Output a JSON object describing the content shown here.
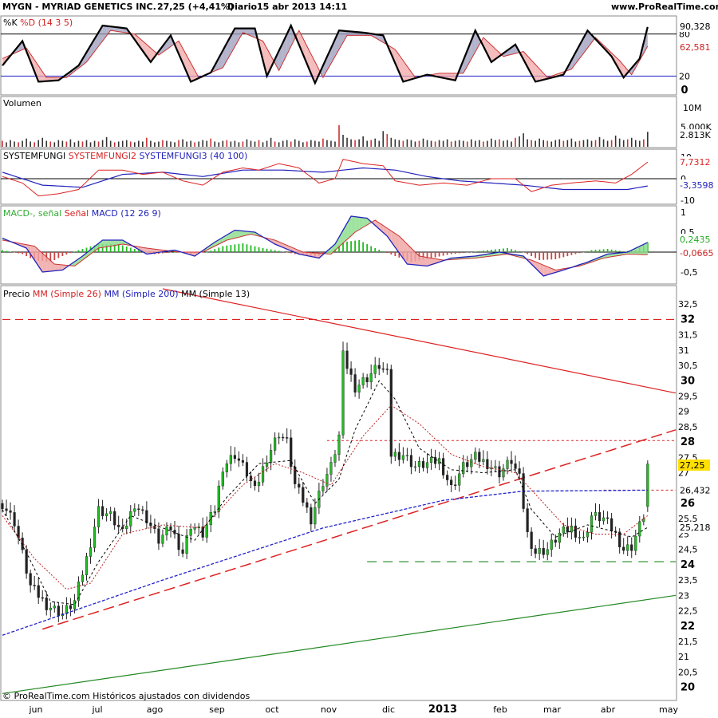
{
  "header": {
    "ticker": "MYGN - MYRIAD GENETICS INC.",
    "quote": "27,25 (+4,41%)",
    "period": "Diario",
    "datetime": "15 abr 2013 14:11",
    "site": "www.ProRealTime.com"
  },
  "footer": "© ProRealTime.com  Históricos ajustados con dividendos",
  "colors": {
    "price_up": "#22bb22",
    "ma26": "#bb2222",
    "ma200": "#2222cc",
    "ma13": "#000000",
    "resistance": "#dd2222",
    "support": "#228822",
    "macd_pos": "#22bb22",
    "macd_neg": "#cc4444"
  },
  "panels": {
    "stoch": {
      "label_a": "%K",
      "label_b": "%D (14 3 5)",
      "axis_top": "100",
      "ticks": [
        "80",
        "20",
        "0"
      ],
      "tag_k": "90,328",
      "tag_d": "62,581"
    },
    "volume": {
      "label": "Volumen",
      "ticks": [
        "10M",
        "5.000K"
      ],
      "tag": "2.813K"
    },
    "sysf": {
      "label_a": "SYSTEMFUNGI",
      "label_b": "SYSTEMFUNGI2",
      "label_c": "SYSTEMFUNGI3 (40 100)",
      "ticks": [
        "10",
        "0",
        "-10"
      ],
      "tag_a": "7,7312",
      "tag_b": "-3,3598"
    },
    "macd": {
      "label_a": "MACD-, señal",
      "label_b": "Señal",
      "label_c": "MACD (12 26 9)",
      "ticks": [
        "1",
        "0,5",
        "-0,5"
      ],
      "tag_a": "0,2435",
      "tag_b": "-0,0665"
    },
    "price": {
      "label_a": "Precio",
      "label_b": "MM (Simple 26)",
      "label_c": "MM (Simple 200)",
      "label_d": "MM (Simple 13)",
      "tag_last": "27,25",
      "tag_ma200": "26,432",
      "tag_ma13": "25,218"
    }
  },
  "chart_data": {
    "type": "candlestick",
    "x_labels": [
      "jun",
      "jul",
      "ago",
      "sep",
      "oct",
      "nov",
      "dic",
      "2013",
      "feb",
      "mar",
      "abr",
      "may"
    ],
    "y_ticks": [
      "32,5",
      "32",
      "31,5",
      "31",
      "30,5",
      "30",
      "29,5",
      "29",
      "28,5",
      "28",
      "27,5",
      "27",
      "26,5",
      "26",
      "25,5",
      "25",
      "24,5",
      "24",
      "23,5",
      "23",
      "22,5",
      "22",
      "21,5",
      "21",
      "20,5",
      "20"
    ],
    "y_ticks_bold": [
      "32",
      "30",
      "28",
      "26",
      "24",
      "22",
      "20"
    ],
    "ylim": [
      19.6,
      33.0
    ],
    "last_price": 27.25,
    "ma200_last": 26.432,
    "ma13_last": 25.218,
    "price_path": [
      [
        0,
        26.0
      ],
      [
        3,
        25.4
      ],
      [
        7,
        23.3
      ],
      [
        11,
        22.7
      ],
      [
        15,
        22.4
      ],
      [
        18,
        22.8
      ],
      [
        21,
        24.2
      ],
      [
        24,
        25.8
      ],
      [
        27,
        25.6
      ],
      [
        30,
        25.0
      ],
      [
        33,
        26.0
      ],
      [
        36,
        25.5
      ],
      [
        39,
        24.8
      ],
      [
        42,
        25.2
      ],
      [
        45,
        24.4
      ],
      [
        47,
        25.3
      ],
      [
        50,
        25.0
      ],
      [
        53,
        25.8
      ],
      [
        55,
        27.2
      ],
      [
        58,
        27.6
      ],
      [
        61,
        27.0
      ],
      [
        63,
        26.4
      ],
      [
        66,
        27.5
      ],
      [
        69,
        28.3
      ],
      [
        71,
        28.0
      ],
      [
        73,
        26.6
      ],
      [
        75,
        26.1
      ],
      [
        77,
        25.5
      ],
      [
        80,
        26.7
      ],
      [
        82,
        27.2
      ],
      [
        84,
        28.2
      ],
      [
        85,
        30.8
      ],
      [
        88,
        29.8
      ],
      [
        91,
        30.1
      ],
      [
        94,
        30.5
      ],
      [
        96,
        30.2
      ],
      [
        97,
        27.6
      ],
      [
        100,
        27.6
      ],
      [
        103,
        27.2
      ],
      [
        106,
        27.3
      ],
      [
        109,
        27.4
      ],
      [
        112,
        26.5
      ],
      [
        115,
        27.2
      ],
      [
        118,
        27.5
      ],
      [
        121,
        27.3
      ],
      [
        124,
        27.0
      ],
      [
        127,
        27.4
      ],
      [
        129,
        26.8
      ],
      [
        131,
        25.0
      ],
      [
        133,
        24.4
      ],
      [
        136,
        24.5
      ],
      [
        139,
        25.0
      ],
      [
        142,
        25.2
      ],
      [
        145,
        24.8
      ],
      [
        147,
        25.6
      ],
      [
        150,
        25.5
      ],
      [
        153,
        25.0
      ],
      [
        155,
        24.5
      ],
      [
        157,
        24.6
      ],
      [
        160,
        25.6
      ],
      [
        161,
        27.25
      ]
    ],
    "ma26_path": [
      [
        0,
        25.6
      ],
      [
        8,
        24.2
      ],
      [
        16,
        23.2
      ],
      [
        22,
        23.4
      ],
      [
        30,
        25.0
      ],
      [
        40,
        25.3
      ],
      [
        50,
        25.2
      ],
      [
        60,
        26.6
      ],
      [
        68,
        27.3
      ],
      [
        75,
        27.0
      ],
      [
        82,
        26.6
      ],
      [
        90,
        28.2
      ],
      [
        97,
        29.2
      ],
      [
        104,
        28.6
      ],
      [
        112,
        27.6
      ],
      [
        120,
        27.2
      ],
      [
        128,
        27.0
      ],
      [
        133,
        26.3
      ],
      [
        140,
        25.3
      ],
      [
        148,
        25.0
      ],
      [
        155,
        25.0
      ],
      [
        161,
        25.6
      ]
    ],
    "ma13_path": [
      [
        0,
        25.8
      ],
      [
        6,
        24.4
      ],
      [
        12,
        22.8
      ],
      [
        18,
        22.7
      ],
      [
        24,
        24.1
      ],
      [
        32,
        25.6
      ],
      [
        40,
        25.2
      ],
      [
        48,
        24.8
      ],
      [
        56,
        26.2
      ],
      [
        64,
        27.3
      ],
      [
        72,
        27.4
      ],
      [
        78,
        26.0
      ],
      [
        84,
        26.8
      ],
      [
        88,
        28.4
      ],
      [
        94,
        30.0
      ],
      [
        98,
        29.4
      ],
      [
        104,
        27.8
      ],
      [
        112,
        27.1
      ],
      [
        120,
        27.0
      ],
      [
        128,
        27.1
      ],
      [
        132,
        25.8
      ],
      [
        138,
        24.9
      ],
      [
        146,
        25.3
      ],
      [
        152,
        25.1
      ],
      [
        157,
        24.9
      ],
      [
        161,
        25.218
      ]
    ],
    "ma200_path": [
      [
        0,
        21.7
      ],
      [
        40,
        23.5
      ],
      [
        80,
        25.2
      ],
      [
        110,
        26.1
      ],
      [
        130,
        26.4
      ],
      [
        161,
        26.432
      ]
    ],
    "levels": [
      {
        "name": "resistance-32",
        "value": 32.0,
        "x0": 0,
        "x1": 168,
        "style": "red-dashed"
      },
      {
        "name": "resistance-28",
        "value": 28.05,
        "x0": 81,
        "x1": 168,
        "style": "red-dotted"
      },
      {
        "name": "support-26-4",
        "value": 26.432,
        "x0": 150,
        "x1": 168,
        "style": "red-dotted"
      },
      {
        "name": "support-24-1",
        "value": 24.1,
        "x0": 91,
        "x1": 168,
        "style": "green-dashed"
      }
    ],
    "trendlines": [
      {
        "name": "downtrend-line",
        "from": [
          40,
          33.0
        ],
        "to": [
          168,
          29.6
        ],
        "style": "red-solid"
      },
      {
        "name": "uptrend-line",
        "from": [
          10,
          21.9
        ],
        "to": [
          168,
          28.4
        ],
        "style": "red-dashed"
      },
      {
        "name": "long-support-line",
        "from": [
          0,
          19.8
        ],
        "to": [
          168,
          23.0
        ],
        "style": "green-solid"
      }
    ],
    "stoch_k": [
      [
        0,
        35
      ],
      [
        5,
        70
      ],
      [
        9,
        12
      ],
      [
        14,
        14
      ],
      [
        19,
        35
      ],
      [
        25,
        92
      ],
      [
        31,
        88
      ],
      [
        37,
        40
      ],
      [
        42,
        78
      ],
      [
        47,
        12
      ],
      [
        52,
        25
      ],
      [
        58,
        88
      ],
      [
        63,
        88
      ],
      [
        66,
        20
      ],
      [
        72,
        92
      ],
      [
        78,
        10
      ],
      [
        84,
        85
      ],
      [
        90,
        82
      ],
      [
        95,
        78
      ],
      [
        100,
        12
      ],
      [
        106,
        22
      ],
      [
        113,
        14
      ],
      [
        118,
        85
      ],
      [
        122,
        40
      ],
      [
        128,
        65
      ],
      [
        133,
        12
      ],
      [
        140,
        22
      ],
      [
        146,
        85
      ],
      [
        152,
        48
      ],
      [
        155,
        18
      ],
      [
        159,
        45
      ],
      [
        161,
        90
      ]
    ],
    "stoch_d": [
      [
        0,
        45
      ],
      [
        6,
        60
      ],
      [
        11,
        18
      ],
      [
        16,
        18
      ],
      [
        21,
        40
      ],
      [
        27,
        85
      ],
      [
        33,
        80
      ],
      [
        39,
        50
      ],
      [
        44,
        70
      ],
      [
        49,
        18
      ],
      [
        55,
        32
      ],
      [
        60,
        82
      ],
      [
        65,
        70
      ],
      [
        69,
        28
      ],
      [
        74,
        85
      ],
      [
        80,
        18
      ],
      [
        86,
        78
      ],
      [
        92,
        78
      ],
      [
        98,
        58
      ],
      [
        103,
        18
      ],
      [
        109,
        24
      ],
      [
        115,
        24
      ],
      [
        120,
        75
      ],
      [
        125,
        48
      ],
      [
        130,
        55
      ],
      [
        136,
        18
      ],
      [
        142,
        30
      ],
      [
        148,
        75
      ],
      [
        154,
        42
      ],
      [
        157,
        22
      ],
      [
        161,
        62.581
      ]
    ],
    "volume": [
      0.8,
      0.6,
      0.9,
      0.7,
      0.6,
      0.8,
      1.1,
      0.7,
      0.6,
      0.9,
      1.2,
      0.8,
      0.7,
      0.6,
      0.9,
      0.8,
      0.7,
      1.0,
      0.6,
      0.8,
      0.7,
      0.9,
      0.6,
      0.8,
      0.7,
      0.9,
      1.3,
      0.8,
      0.6,
      0.7,
      0.8,
      0.9,
      0.7,
      0.6,
      0.8,
      0.7,
      1.2,
      0.8,
      0.6,
      0.7,
      0.9,
      0.8,
      0.7,
      0.6,
      0.9,
      1.0,
      0.7,
      0.8,
      0.6,
      0.7,
      0.9,
      0.8,
      1.1,
      0.7,
      0.6,
      0.8,
      0.9,
      0.7,
      0.8,
      0.6,
      0.7,
      1.0,
      0.8,
      0.7,
      0.9,
      0.6,
      0.8,
      1.2,
      0.7,
      0.6,
      0.8,
      0.9,
      0.7,
      1.0,
      0.8,
      0.6,
      0.7,
      0.9,
      0.8,
      0.7,
      1.1,
      0.9,
      0.8,
      0.7,
      2.9,
      1.6,
      1.2,
      1.0,
      0.9,
      1.0,
      1.4,
      0.8,
      0.9,
      1.1,
      0.8,
      2.1,
      1.7,
      1.2,
      1.0,
      0.9,
      0.8,
      1.0,
      0.9,
      0.7,
      0.8,
      1.1,
      0.9,
      0.8,
      0.7,
      0.9,
      0.8,
      1.0,
      0.7,
      0.8,
      0.9,
      0.8,
      0.7,
      1.0,
      0.8,
      0.9,
      0.7,
      0.8,
      1.1,
      0.9,
      1.0,
      0.8,
      0.9,
      0.7,
      1.2,
      1.4,
      1.8,
      1.0,
      0.9,
      0.8,
      1.1,
      0.9,
      0.8,
      0.7,
      0.9,
      1.0,
      0.8,
      0.9,
      1.1,
      0.7,
      0.8,
      0.9,
      1.0,
      0.8,
      0.9,
      1.3,
      1.0,
      0.8,
      0.9,
      1.5,
      1.1,
      0.9,
      1.0,
      1.2,
      0.9,
      0.8,
      1.0,
      2.0
    ],
    "sysf_main": [
      [
        0,
        1
      ],
      [
        5,
        -2
      ],
      [
        9,
        -8
      ],
      [
        14,
        -7
      ],
      [
        19,
        -5
      ],
      [
        24,
        4
      ],
      [
        30,
        4
      ],
      [
        35,
        2
      ],
      [
        40,
        3
      ],
      [
        45,
        -1
      ],
      [
        50,
        -3
      ],
      [
        55,
        3
      ],
      [
        60,
        5
      ],
      [
        64,
        4
      ],
      [
        69,
        7
      ],
      [
        74,
        5
      ],
      [
        79,
        -2
      ],
      [
        83,
        0
      ],
      [
        85,
        9
      ],
      [
        90,
        7
      ],
      [
        95,
        6
      ],
      [
        98,
        -1
      ],
      [
        104,
        -3
      ],
      [
        110,
        -2
      ],
      [
        116,
        -3
      ],
      [
        122,
        0
      ],
      [
        128,
        0
      ],
      [
        132,
        -6
      ],
      [
        137,
        -3
      ],
      [
        142,
        -2
      ],
      [
        148,
        -1
      ],
      [
        153,
        -2
      ],
      [
        157,
        2
      ],
      [
        161,
        7.7312
      ]
    ],
    "sysf_signal": [
      [
        0,
        3
      ],
      [
        10,
        -3
      ],
      [
        20,
        -4
      ],
      [
        30,
        2
      ],
      [
        40,
        3
      ],
      [
        50,
        1
      ],
      [
        60,
        4
      ],
      [
        70,
        4
      ],
      [
        80,
        3
      ],
      [
        90,
        5
      ],
      [
        98,
        4
      ],
      [
        106,
        1
      ],
      [
        114,
        -1
      ],
      [
        122,
        -2
      ],
      [
        130,
        -3
      ],
      [
        140,
        -5
      ],
      [
        150,
        -5
      ],
      [
        156,
        -5
      ],
      [
        161,
        -3.3598
      ]
    ],
    "macd_hist": [
      [
        0,
        0.05
      ],
      [
        5,
        -0.05
      ],
      [
        8,
        -0.2
      ],
      [
        12,
        -0.25
      ],
      [
        15,
        -0.1
      ],
      [
        19,
        0.05
      ],
      [
        24,
        0.2
      ],
      [
        29,
        0.2
      ],
      [
        34,
        0.05
      ],
      [
        38,
        -0.05
      ],
      [
        43,
        0.0
      ],
      [
        47,
        -0.05
      ],
      [
        51,
        0.0
      ],
      [
        55,
        0.15
      ],
      [
        60,
        0.22
      ],
      [
        64,
        0.12
      ],
      [
        68,
        0.05
      ],
      [
        73,
        -0.05
      ],
      [
        78,
        -0.12
      ],
      [
        82,
        0.0
      ],
      [
        85,
        0.25
      ],
      [
        89,
        0.3
      ],
      [
        93,
        0.1
      ],
      [
        98,
        -0.1
      ],
      [
        102,
        -0.25
      ],
      [
        107,
        -0.15
      ],
      [
        112,
        -0.05
      ],
      [
        117,
        0.0
      ],
      [
        121,
        0.05
      ],
      [
        126,
        0.1
      ],
      [
        130,
        0.0
      ],
      [
        134,
        -0.2
      ],
      [
        138,
        -0.18
      ],
      [
        143,
        -0.05
      ],
      [
        147,
        0.05
      ],
      [
        151,
        0.08
      ],
      [
        155,
        0.02
      ],
      [
        158,
        0.05
      ],
      [
        161,
        0.2435
      ]
    ],
    "macd_line": [
      [
        0,
        0.35
      ],
      [
        6,
        0.1
      ],
      [
        10,
        -0.5
      ],
      [
        15,
        -0.45
      ],
      [
        20,
        -0.1
      ],
      [
        25,
        0.3
      ],
      [
        30,
        0.3
      ],
      [
        36,
        -0.05
      ],
      [
        43,
        0.05
      ],
      [
        48,
        -0.1
      ],
      [
        53,
        0.25
      ],
      [
        58,
        0.55
      ],
      [
        63,
        0.5
      ],
      [
        68,
        0.2
      ],
      [
        74,
        -0.05
      ],
      [
        79,
        -0.15
      ],
      [
        83,
        0.2
      ],
      [
        87,
        0.9
      ],
      [
        91,
        0.85
      ],
      [
        96,
        0.4
      ],
      [
        101,
        -0.3
      ],
      [
        106,
        -0.35
      ],
      [
        112,
        -0.15
      ],
      [
        118,
        -0.1
      ],
      [
        124,
        0.0
      ],
      [
        130,
        -0.1
      ],
      [
        135,
        -0.6
      ],
      [
        140,
        -0.45
      ],
      [
        146,
        -0.25
      ],
      [
        151,
        -0.05
      ],
      [
        156,
        0.0
      ],
      [
        161,
        0.2435
      ]
    ],
    "macd_signal": [
      [
        0,
        0.3
      ],
      [
        8,
        0.15
      ],
      [
        13,
        -0.3
      ],
      [
        18,
        -0.35
      ],
      [
        24,
        0.1
      ],
      [
        30,
        0.2
      ],
      [
        36,
        0.1
      ],
      [
        44,
        0.0
      ],
      [
        50,
        0.0
      ],
      [
        56,
        0.3
      ],
      [
        62,
        0.45
      ],
      [
        68,
        0.3
      ],
      [
        75,
        0.0
      ],
      [
        82,
        -0.05
      ],
      [
        88,
        0.5
      ],
      [
        93,
        0.8
      ],
      [
        99,
        0.4
      ],
      [
        104,
        -0.1
      ],
      [
        110,
        -0.2
      ],
      [
        118,
        -0.15
      ],
      [
        126,
        -0.05
      ],
      [
        132,
        -0.2
      ],
      [
        138,
        -0.45
      ],
      [
        144,
        -0.35
      ],
      [
        150,
        -0.15
      ],
      [
        156,
        -0.05
      ],
      [
        161,
        -0.0665
      ]
    ]
  }
}
